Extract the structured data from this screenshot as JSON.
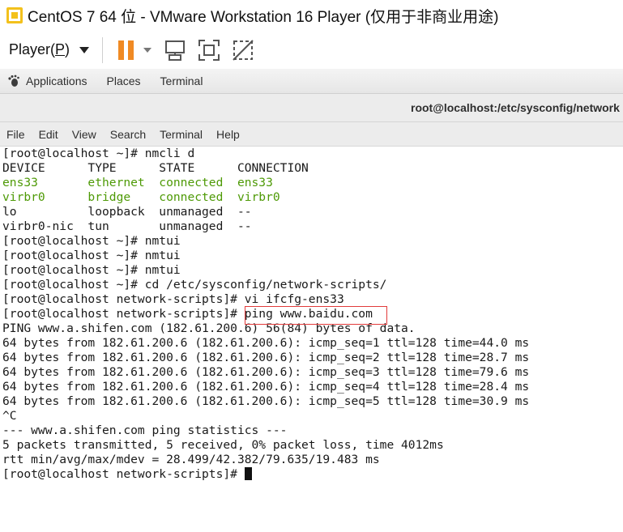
{
  "window": {
    "title": "CentOS 7 64 位 - VMware Workstation 16 Player (仅用于非商业用途)"
  },
  "toolbar": {
    "player_label": "Player(",
    "player_mnemonic": "P",
    "player_suffix": ")",
    "pause_color": "#f08a24",
    "icons": [
      "pause-icon",
      "send-ctrl-alt-del-icon",
      "fullscreen-icon",
      "unity-icon"
    ]
  },
  "gnome": {
    "applications": "Applications",
    "places": "Places",
    "terminal": "Terminal"
  },
  "terminal": {
    "title": "root@localhost:/etc/sysconfig/network",
    "menu": [
      "File",
      "Edit",
      "View",
      "Search",
      "Terminal",
      "Help"
    ],
    "lines": [
      "[root@localhost ~]# nmcli d",
      "DEVICE      TYPE      STATE      CONNECTION",
      "ens33       ethernet  connected  ens33",
      "virbr0      bridge    connected  virbr0",
      "lo          loopback  unmanaged  --",
      "virbr0-nic  tun       unmanaged  --",
      "[root@localhost ~]# nmtui",
      "[root@localhost ~]# nmtui",
      "[root@localhost ~]# nmtui",
      "[root@localhost ~]# cd /etc/sysconfig/network-scripts/",
      "[root@localhost network-scripts]# vi ifcfg-ens33",
      "[root@localhost network-scripts]# ping www.baidu.com",
      "PING www.a.shifen.com (182.61.200.6) 56(84) bytes of data.",
      "64 bytes from 182.61.200.6 (182.61.200.6): icmp_seq=1 ttl=128 time=44.0 ms",
      "64 bytes from 182.61.200.6 (182.61.200.6): icmp_seq=2 ttl=128 time=28.7 ms",
      "64 bytes from 182.61.200.6 (182.61.200.6): icmp_seq=3 ttl=128 time=79.6 ms",
      "64 bytes from 182.61.200.6 (182.61.200.6): icmp_seq=4 ttl=128 time=28.4 ms",
      "64 bytes from 182.61.200.6 (182.61.200.6): icmp_seq=5 ttl=128 time=30.9 ms",
      "^C",
      "--- www.a.shifen.com ping statistics ---",
      "5 packets transmitted, 5 received, 0% packet loss, time 4012ms",
      "rtt min/avg/max/mdev = 28.499/42.382/79.635/19.483 ms",
      "[root@localhost network-scripts]# "
    ],
    "green_lines": [
      2,
      3
    ],
    "highlighted_command": "ping www.baidu.com",
    "highlight_color": "#e23b3b",
    "text_color": "#1a1a1a",
    "green_color": "#4e9a06"
  }
}
